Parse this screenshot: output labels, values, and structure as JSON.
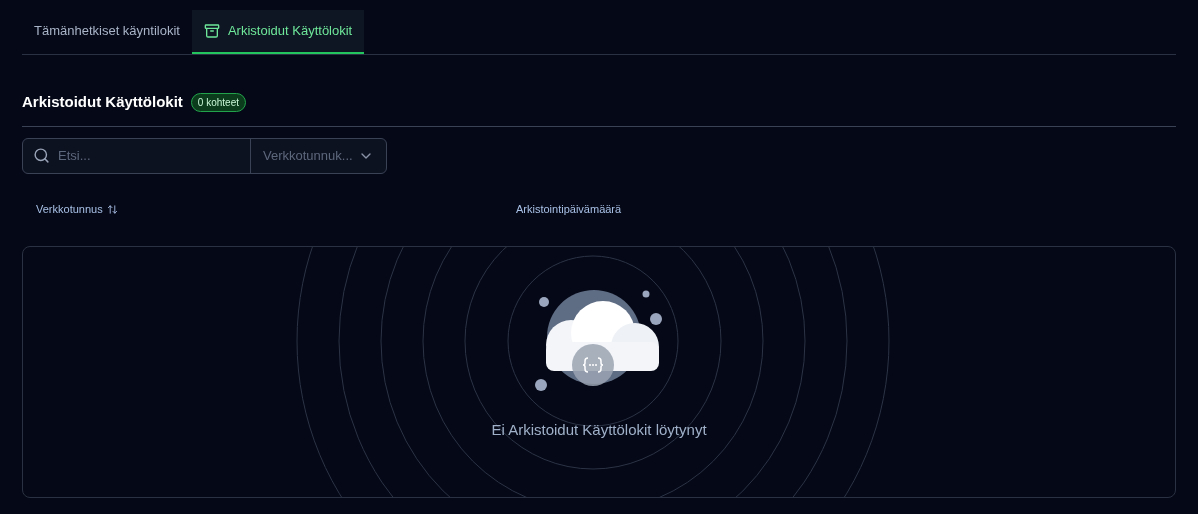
{
  "tabs": [
    {
      "label": "Tämänhetkiset käyntilokit",
      "selected": false,
      "icon": false
    },
    {
      "label": "Arkistoidut Käyttölokit",
      "selected": true,
      "icon": true
    }
  ],
  "section": {
    "title": "Arkistoidut Käyttölokit",
    "count_badge": "0 kohteet"
  },
  "search": {
    "placeholder": "Etsi..."
  },
  "filter": {
    "placeholder": "Verkkotunnuk..."
  },
  "table": {
    "columns": [
      {
        "label": "Verkkotunnus",
        "sortable": true
      },
      {
        "label": "Arkistointipäivämäärä",
        "sortable": false
      }
    ]
  },
  "empty_state": {
    "message": "Ei Arkistoidut Käyttölokit löytynyt"
  }
}
